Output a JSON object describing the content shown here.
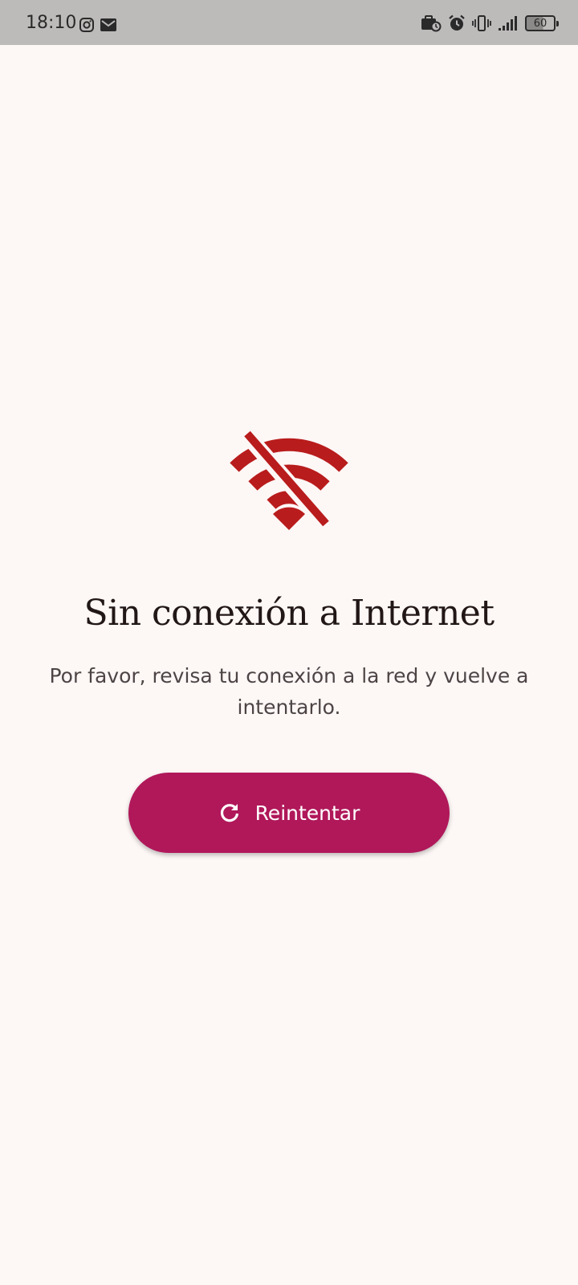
{
  "status_bar": {
    "time": "18:10",
    "battery_level": "60",
    "left_icons": [
      "instagram-icon",
      "mail-icon"
    ],
    "right_icons": [
      "work-profile-icon",
      "alarm-icon",
      "vibrate-icon",
      "signal-icon",
      "battery-icon"
    ]
  },
  "offline": {
    "icon": "wifi-off-icon",
    "title": "Sin conexión a Internet",
    "message": "Por favor, revisa tu conexión a la red y vuelve a intentarlo."
  },
  "retry_button": {
    "label": "Reintentar",
    "icon": "refresh-icon"
  },
  "colors": {
    "background": "#fdf7f6",
    "status_bar": "#bdbbba",
    "icon_red": "#b91c1c",
    "button": "#b0185a",
    "title_text": "#221717",
    "body_text": "#4d4545"
  }
}
